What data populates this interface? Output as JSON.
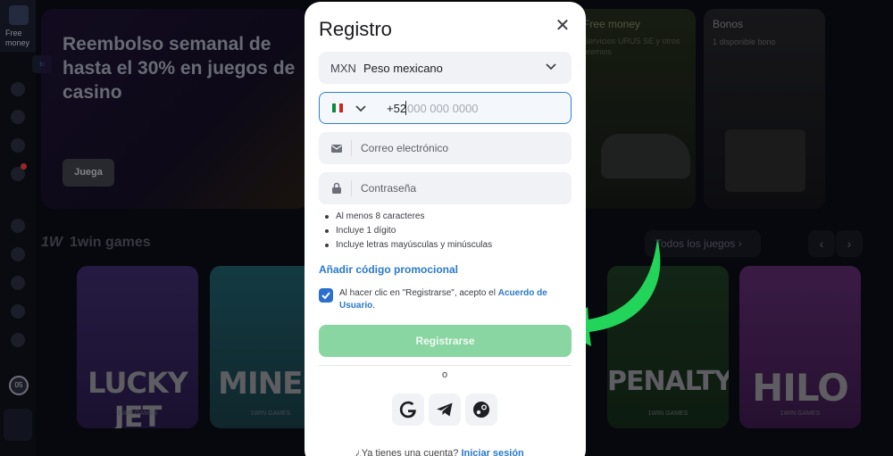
{
  "sidebar": {
    "free_money": "Free money",
    "avatar_level": "05",
    "expand_icon": "double-chevron-right-icon"
  },
  "background": {
    "hero": {
      "title": "Reembolso semanal de hasta el 30% en juegos de casino",
      "button": "Juega"
    },
    "promo_free_money": {
      "title": "Free money",
      "subtitle": "Servicios URUS SE y otros premios"
    },
    "promo_bonos": {
      "title": "Bonos",
      "subtitle": "1 disponible bono"
    },
    "games_section": {
      "title": "1win games",
      "logo": "1W",
      "all_games": "Todos los juegos",
      "cards": [
        {
          "name": "LUCKY JET",
          "studio": "1WIN GAMES"
        },
        {
          "name": "MINES",
          "studio": "1WIN GAMES"
        },
        {
          "name": "PENALTY",
          "studio": "1WIN GAMES"
        },
        {
          "name": "HILO",
          "studio": "1WIN GAMES"
        }
      ]
    }
  },
  "modal": {
    "title": "Registro",
    "currency": {
      "code": "MXN",
      "name": "Peso mexicano"
    },
    "phone": {
      "prefix": "+52",
      "placeholder": "000 000 0000"
    },
    "email_placeholder": "Correo electrónico",
    "password_placeholder": "Contraseña",
    "password_rules": [
      "Al menos 8 caracteres",
      "Incluye 1 dígito",
      "Incluye letras mayúsculas y minúsculas"
    ],
    "promo_code_link": "Añadir código promocional",
    "consent_text": "Al hacer clic en \"Registrarse\", acepto el",
    "consent_link": "Acuerdo de Usuario",
    "consent_end": ".",
    "consent_checked": true,
    "submit_label": "Registrarse",
    "or_label": "o",
    "social_logins": [
      "google-icon",
      "telegram-icon",
      "steam-icon"
    ],
    "login_prompt": "¿Ya tienes una cuenta?",
    "login_link": "Iniciar sesión"
  },
  "colors": {
    "accent_blue": "#2a7ac9",
    "submit_green": "#8ad6a3",
    "arrow_green": "#22d45a"
  }
}
